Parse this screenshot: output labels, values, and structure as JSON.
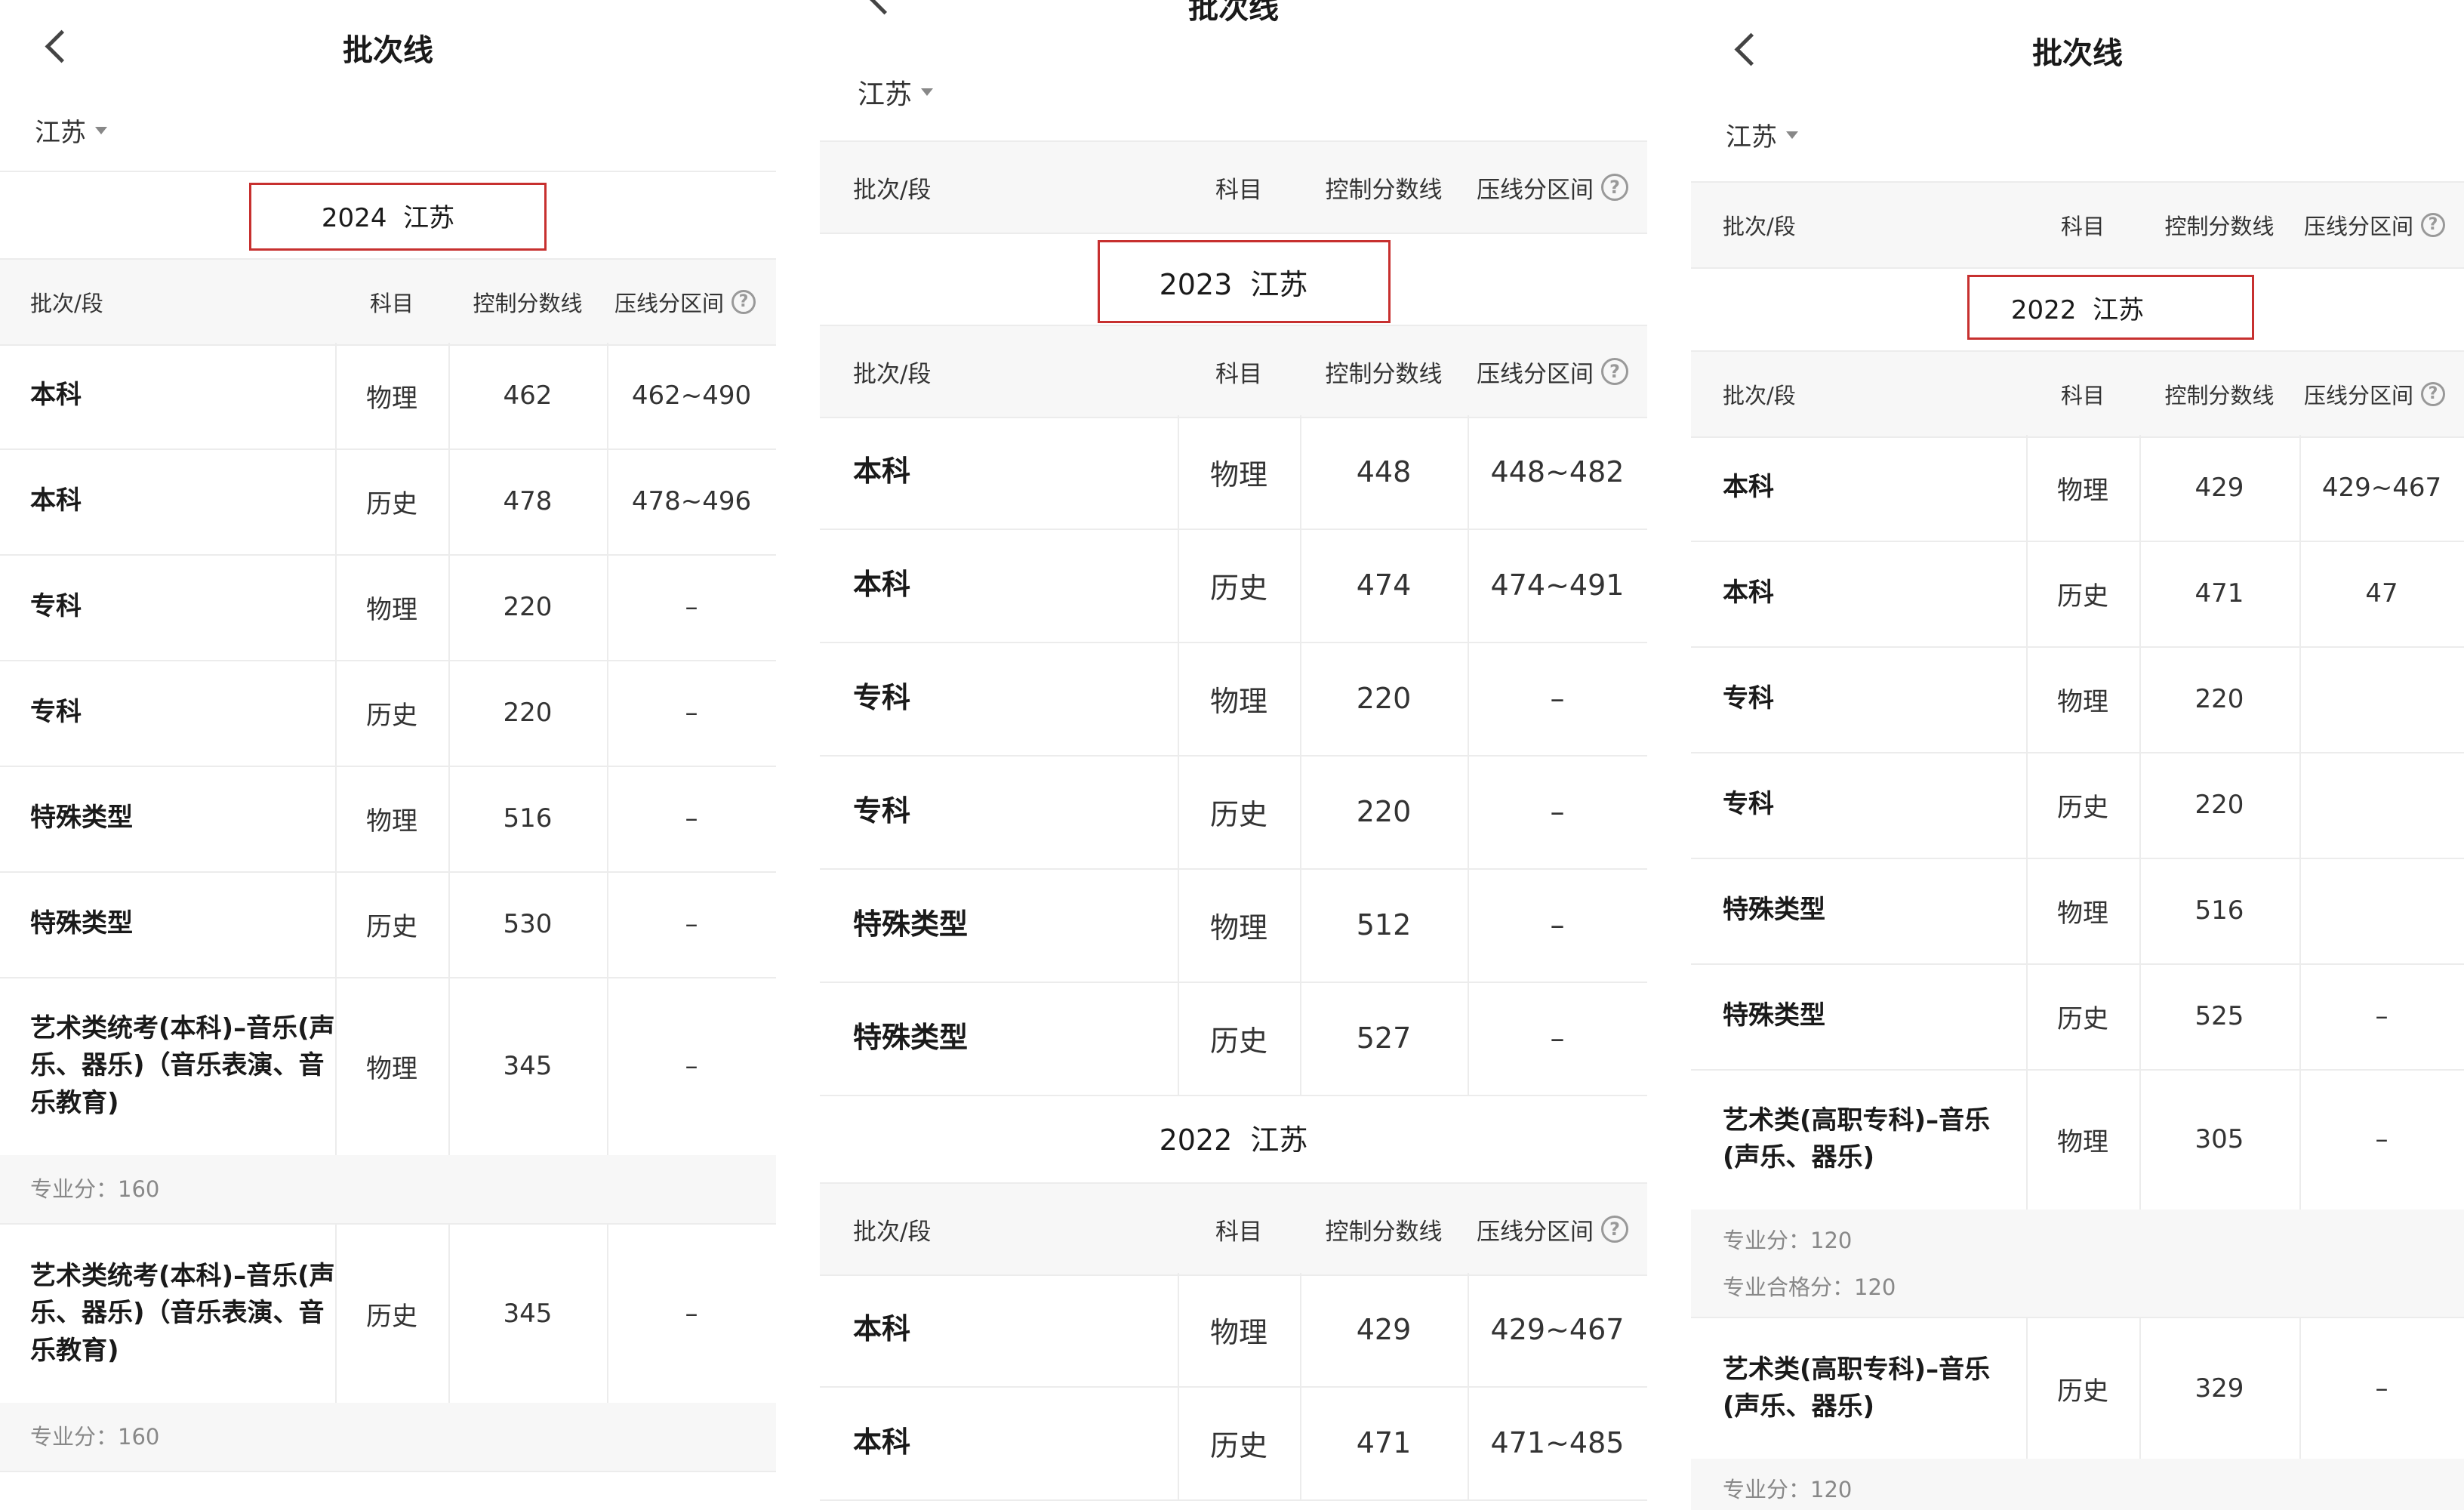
{
  "page_title": "批次线",
  "province": "江苏",
  "columns": {
    "batch": "批次/段",
    "subject": "科目",
    "score": "控制分数线",
    "range": "压线分区间",
    "help": "?"
  },
  "panel1": {
    "section_title": "2024  江苏",
    "rows": [
      {
        "batch": "本科",
        "subject": "物理",
        "score": "462",
        "range": "462~490"
      },
      {
        "batch": "本科",
        "subject": "历史",
        "score": "478",
        "range": "478~496"
      },
      {
        "batch": "专科",
        "subject": "物理",
        "score": "220",
        "range": "–"
      },
      {
        "batch": "专科",
        "subject": "历史",
        "score": "220",
        "range": "–"
      },
      {
        "batch": "特殊类型",
        "subject": "物理",
        "score": "516",
        "range": "–"
      },
      {
        "batch": "特殊类型",
        "subject": "历史",
        "score": "530",
        "range": "–"
      },
      {
        "batch": "艺术类统考(本科)–音乐(声乐、器乐)（音乐表演、音乐教育)",
        "subject": "物理",
        "score": "345",
        "range": "–",
        "note": "专业分：160"
      },
      {
        "batch": "艺术类统考(本科)–音乐(声乐、器乐)（音乐表演、音乐教育)",
        "subject": "历史",
        "score": "345",
        "range": "–",
        "note": "专业分：160"
      }
    ]
  },
  "panel2": {
    "section_title_2023": "2023  江苏",
    "rows_2023": [
      {
        "batch": "本科",
        "subject": "物理",
        "score": "448",
        "range": "448~482"
      },
      {
        "batch": "本科",
        "subject": "历史",
        "score": "474",
        "range": "474~491"
      },
      {
        "batch": "专科",
        "subject": "物理",
        "score": "220",
        "range": "–"
      },
      {
        "batch": "专科",
        "subject": "历史",
        "score": "220",
        "range": "–"
      },
      {
        "batch": "特殊类型",
        "subject": "物理",
        "score": "512",
        "range": "–"
      },
      {
        "batch": "特殊类型",
        "subject": "历史",
        "score": "527",
        "range": "–"
      }
    ],
    "section_title_2022": "2022  江苏",
    "rows_2022": [
      {
        "batch": "本科",
        "subject": "物理",
        "score": "429",
        "range": "429~467"
      },
      {
        "batch": "本科",
        "subject": "历史",
        "score": "471",
        "range": "471~485"
      }
    ]
  },
  "panel3": {
    "section_title": "2022  江苏",
    "rows": [
      {
        "batch": "本科",
        "subject": "物理",
        "score": "429",
        "range": "429~467"
      },
      {
        "batch": "本科",
        "subject": "历史",
        "score": "471",
        "range": "47"
      },
      {
        "batch": "专科",
        "subject": "物理",
        "score": "220",
        "range": ""
      },
      {
        "batch": "专科",
        "subject": "历史",
        "score": "220",
        "range": ""
      },
      {
        "batch": "特殊类型",
        "subject": "物理",
        "score": "516",
        "range": ""
      },
      {
        "batch": "特殊类型",
        "subject": "历史",
        "score": "525",
        "range": "–"
      },
      {
        "batch": "艺术类(高职专科)–音乐(声乐、器乐)",
        "subject": "物理",
        "score": "305",
        "range": "–",
        "note1": "专业分：120",
        "note2": "专业合格分：120"
      },
      {
        "batch": "艺术类(高职专科)–音乐(声乐、器乐)",
        "subject": "历史",
        "score": "329",
        "range": "–",
        "note1": "专业分：120"
      }
    ]
  },
  "colors": {
    "accent_box": "#c7302f",
    "header_bg": "#f7f7f7",
    "divider": "#ececec"
  }
}
